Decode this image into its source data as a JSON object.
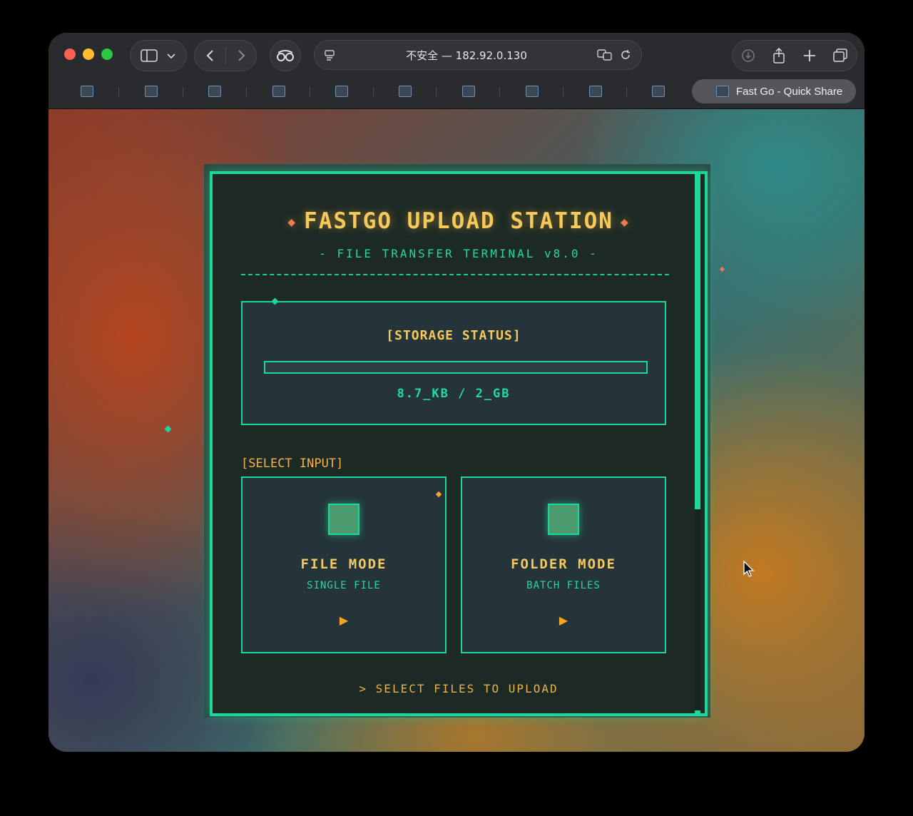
{
  "browser": {
    "address": "不安全 — 182.92.0.130",
    "active_tab_title": "Fast Go - Quick Share",
    "traffic_light_colors": [
      "#fe5f57",
      "#febc2e",
      "#28c840"
    ]
  },
  "page": {
    "title": "FASTGO UPLOAD STATION",
    "subtitle": "- FILE TRANSFER TERMINAL v8.0 -",
    "storage": {
      "heading": "[STORAGE STATUS]",
      "usage_text": "8.7_KB / 2_GB",
      "used_fraction": 0.0
    },
    "select_input_label": "[SELECT INPUT]",
    "modes": [
      {
        "title": "FILE MODE",
        "subtitle": "SINGLE FILE",
        "arrow": "▶"
      },
      {
        "title": "FOLDER MODE",
        "subtitle": "BATCH FILES",
        "arrow": "▶"
      }
    ],
    "footer": "> SELECT FILES TO UPLOAD"
  },
  "colors": {
    "accent_green": "#1fd69a",
    "accent_gold": "#f5c95c",
    "accent_orange": "#ee7a50"
  }
}
